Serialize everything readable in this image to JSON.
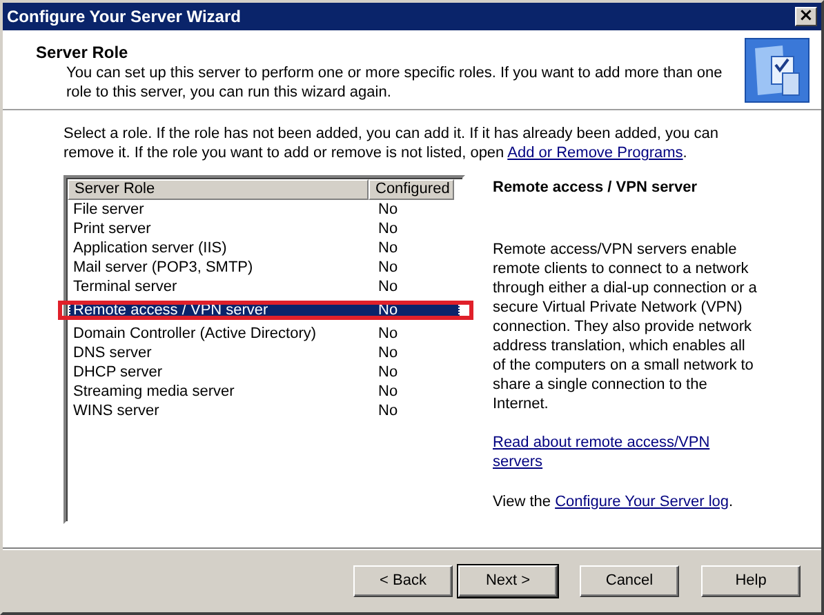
{
  "window": {
    "title": "Configure Your Server Wizard",
    "close": "×"
  },
  "header": {
    "title": "Server Role",
    "description": "You can set up this server to perform one or more specific roles. If you want to add more than one role to this server, you can run this wizard again."
  },
  "intro": {
    "text_before": "Select a role. If the role has not been added, you can add it. If it has already been added, you can remove it. If the role you want to add or remove is not listed, open ",
    "link": "Add or Remove Programs",
    "text_after": "."
  },
  "table": {
    "columns": [
      "Server Role",
      "Configured"
    ],
    "rows": [
      {
        "role": "File server",
        "configured": "No",
        "selected": false,
        "outlined": false
      },
      {
        "role": "Print server",
        "configured": "No",
        "selected": false,
        "outlined": false
      },
      {
        "role": "Application server (IIS)",
        "configured": "No",
        "selected": false,
        "outlined": false
      },
      {
        "role": "Mail server (POP3, SMTP)",
        "configured": "No",
        "selected": false,
        "outlined": false
      },
      {
        "role": "Terminal server",
        "configured": "No",
        "selected": false,
        "outlined": false
      },
      {
        "role": "Remote access / VPN server",
        "configured": "No",
        "selected": true,
        "outlined": true
      },
      {
        "role": "Domain Controller (Active Directory)",
        "configured": "No",
        "selected": false,
        "outlined": false
      },
      {
        "role": "DNS server",
        "configured": "No",
        "selected": false,
        "outlined": false
      },
      {
        "role": "DHCP server",
        "configured": "No",
        "selected": false,
        "outlined": false
      },
      {
        "role": "Streaming media server",
        "configured": "No",
        "selected": false,
        "outlined": false
      },
      {
        "role": "WINS server",
        "configured": "No",
        "selected": false,
        "outlined": false
      }
    ]
  },
  "details": {
    "title": "Remote access / VPN server",
    "description": "Remote access/VPN servers enable remote clients to connect to a network through either a dial-up connection or a secure Virtual Private Network (VPN) connection. They also provide network address translation, which enables all of the computers on a small network to share a single connection to the Internet.",
    "read_link": "Read about remote access/VPN servers",
    "log_before": "View the ",
    "log_link": "Configure Your Server log",
    "log_after": "."
  },
  "buttons": [
    {
      "label": "< Back",
      "default": false
    },
    {
      "label": "Next >",
      "default": true
    },
    {
      "label": "Cancel",
      "default": false
    },
    {
      "label": "Help",
      "default": false
    }
  ]
}
